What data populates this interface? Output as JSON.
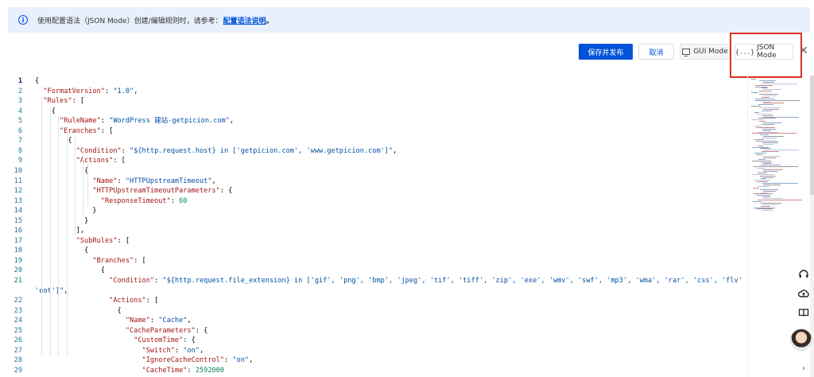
{
  "notice": {
    "icon": "info-icon",
    "text": "使用配置语法（JSON Mode）创建/编辑规则时，请参考：",
    "link": "配置语法说明",
    "suffix": "。"
  },
  "toolbar": {
    "save_publish": "保存并发布",
    "cancel": "取消",
    "gui_mode": "GUI Mode",
    "json_mode": "JSON Mode",
    "json_mode_icon": "{...}"
  },
  "colors": {
    "primary": "#0052d9",
    "notice_bg": "#e8f0fd",
    "highlight": "#d93025",
    "json_key": "#a31515",
    "json_string": "#0451a5",
    "json_number": "#098658"
  },
  "editor": {
    "lines": [
      {
        "num": "1",
        "tokens": [
          {
            "t": "p",
            "v": "{"
          }
        ]
      },
      {
        "num": "2",
        "tokens": [
          {
            "t": "p",
            "v": "  "
          },
          {
            "t": "k",
            "v": "\"FormatVersion\""
          },
          {
            "t": "p",
            "v": ": "
          },
          {
            "t": "s",
            "v": "\"1.0\""
          },
          {
            "t": "p",
            "v": ","
          }
        ]
      },
      {
        "num": "3",
        "tokens": [
          {
            "t": "p",
            "v": "  "
          },
          {
            "t": "k",
            "v": "\"Rules\""
          },
          {
            "t": "p",
            "v": ": ["
          }
        ]
      },
      {
        "num": "4",
        "tokens": [
          {
            "t": "p",
            "v": "    {"
          }
        ]
      },
      {
        "num": "5",
        "tokens": [
          {
            "t": "p",
            "v": "      "
          },
          {
            "t": "k",
            "v": "\"RuleName\""
          },
          {
            "t": "p",
            "v": ": "
          },
          {
            "t": "s",
            "v": "\"WordPress 建站-getpicion.com\""
          },
          {
            "t": "p",
            "v": ","
          }
        ]
      },
      {
        "num": "6",
        "tokens": [
          {
            "t": "p",
            "v": "      "
          },
          {
            "t": "k",
            "v": "\"Branches\""
          },
          {
            "t": "p",
            "v": ": ["
          }
        ]
      },
      {
        "num": "7",
        "tokens": [
          {
            "t": "p",
            "v": "        {"
          }
        ]
      },
      {
        "num": "8",
        "tokens": [
          {
            "t": "p",
            "v": "          "
          },
          {
            "t": "k",
            "v": "\"Condition\""
          },
          {
            "t": "p",
            "v": ": "
          },
          {
            "t": "s",
            "v": "\"${http.request.host} in ['getpicion.com', 'www.getpicion.com']\""
          },
          {
            "t": "p",
            "v": ","
          }
        ]
      },
      {
        "num": "9",
        "tokens": [
          {
            "t": "p",
            "v": "          "
          },
          {
            "t": "k",
            "v": "\"Actions\""
          },
          {
            "t": "p",
            "v": ": ["
          }
        ]
      },
      {
        "num": "10",
        "tokens": [
          {
            "t": "p",
            "v": "            {"
          }
        ]
      },
      {
        "num": "11",
        "tokens": [
          {
            "t": "p",
            "v": "              "
          },
          {
            "t": "k",
            "v": "\"Name\""
          },
          {
            "t": "p",
            "v": ": "
          },
          {
            "t": "s",
            "v": "\"HTTPUpstreamTimeout\""
          },
          {
            "t": "p",
            "v": ","
          }
        ]
      },
      {
        "num": "12",
        "tokens": [
          {
            "t": "p",
            "v": "              "
          },
          {
            "t": "k",
            "v": "\"HTTPUpstreamTimeoutParameters\""
          },
          {
            "t": "p",
            "v": ": {"
          }
        ]
      },
      {
        "num": "13",
        "tokens": [
          {
            "t": "p",
            "v": "                "
          },
          {
            "t": "k",
            "v": "\"ResponseTimeout\""
          },
          {
            "t": "p",
            "v": ": "
          },
          {
            "t": "n",
            "v": "60"
          }
        ]
      },
      {
        "num": "14",
        "tokens": [
          {
            "t": "p",
            "v": "              }"
          }
        ]
      },
      {
        "num": "15",
        "tokens": [
          {
            "t": "p",
            "v": "            }"
          }
        ]
      },
      {
        "num": "16",
        "tokens": [
          {
            "t": "p",
            "v": "          ],"
          }
        ]
      },
      {
        "num": "17",
        "tokens": [
          {
            "t": "p",
            "v": "          "
          },
          {
            "t": "k",
            "v": "\"SubRules\""
          },
          {
            "t": "p",
            "v": ": ["
          }
        ]
      },
      {
        "num": "18",
        "tokens": [
          {
            "t": "p",
            "v": "            {"
          }
        ]
      },
      {
        "num": "19",
        "tokens": [
          {
            "t": "p",
            "v": "              "
          },
          {
            "t": "k",
            "v": "\"Branches\""
          },
          {
            "t": "p",
            "v": ": ["
          }
        ]
      },
      {
        "num": "20",
        "tokens": [
          {
            "t": "p",
            "v": "                {"
          }
        ]
      },
      {
        "num": "21",
        "tokens": [
          {
            "t": "p",
            "v": "                  "
          },
          {
            "t": "k",
            "v": "\"Condition\""
          },
          {
            "t": "p",
            "v": ": "
          },
          {
            "t": "s",
            "v": "\"${http.request.file_extension} in ['gif', 'png', 'bmp', 'jpeg', 'tif', 'tiff', 'zip', 'exe', 'wmv', 'swf', 'mp3', 'wma', 'rar', 'css', 'flv'"
          }
        ]
      },
      {
        "num": "",
        "tokens": [
          {
            "t": "s",
            "v": "'eot']\""
          },
          {
            "t": "p",
            "v": ","
          }
        ]
      },
      {
        "num": "22",
        "tokens": [
          {
            "t": "p",
            "v": "                  "
          },
          {
            "t": "k",
            "v": "\"Actions\""
          },
          {
            "t": "p",
            "v": ": ["
          }
        ]
      },
      {
        "num": "23",
        "tokens": [
          {
            "t": "p",
            "v": "                    {"
          }
        ]
      },
      {
        "num": "24",
        "tokens": [
          {
            "t": "p",
            "v": "                      "
          },
          {
            "t": "k",
            "v": "\"Name\""
          },
          {
            "t": "p",
            "v": ": "
          },
          {
            "t": "s",
            "v": "\"Cache\""
          },
          {
            "t": "p",
            "v": ","
          }
        ]
      },
      {
        "num": "25",
        "tokens": [
          {
            "t": "p",
            "v": "                      "
          },
          {
            "t": "k",
            "v": "\"CacheParameters\""
          },
          {
            "t": "p",
            "v": ": {"
          }
        ]
      },
      {
        "num": "26",
        "tokens": [
          {
            "t": "p",
            "v": "                        "
          },
          {
            "t": "k",
            "v": "\"CustomTime\""
          },
          {
            "t": "p",
            "v": ": {"
          }
        ]
      },
      {
        "num": "27",
        "tokens": [
          {
            "t": "p",
            "v": "                          "
          },
          {
            "t": "k",
            "v": "\"Switch\""
          },
          {
            "t": "p",
            "v": ": "
          },
          {
            "t": "s",
            "v": "\"on\""
          },
          {
            "t": "p",
            "v": ","
          }
        ]
      },
      {
        "num": "28",
        "tokens": [
          {
            "t": "p",
            "v": "                          "
          },
          {
            "t": "k",
            "v": "\"IgnoreCacheControl\""
          },
          {
            "t": "p",
            "v": ": "
          },
          {
            "t": "s",
            "v": "\"on\""
          },
          {
            "t": "p",
            "v": ","
          }
        ]
      },
      {
        "num": "29",
        "tokens": [
          {
            "t": "p",
            "v": "                          "
          },
          {
            "t": "k",
            "v": "\"CacheTime\""
          },
          {
            "t": "p",
            "v": ": "
          },
          {
            "t": "n",
            "v": "2592000"
          }
        ]
      }
    ]
  },
  "float_panel": {
    "icons": [
      "headset-icon",
      "cloud-upload-icon",
      "book-icon",
      "chevron-right-icon"
    ]
  }
}
